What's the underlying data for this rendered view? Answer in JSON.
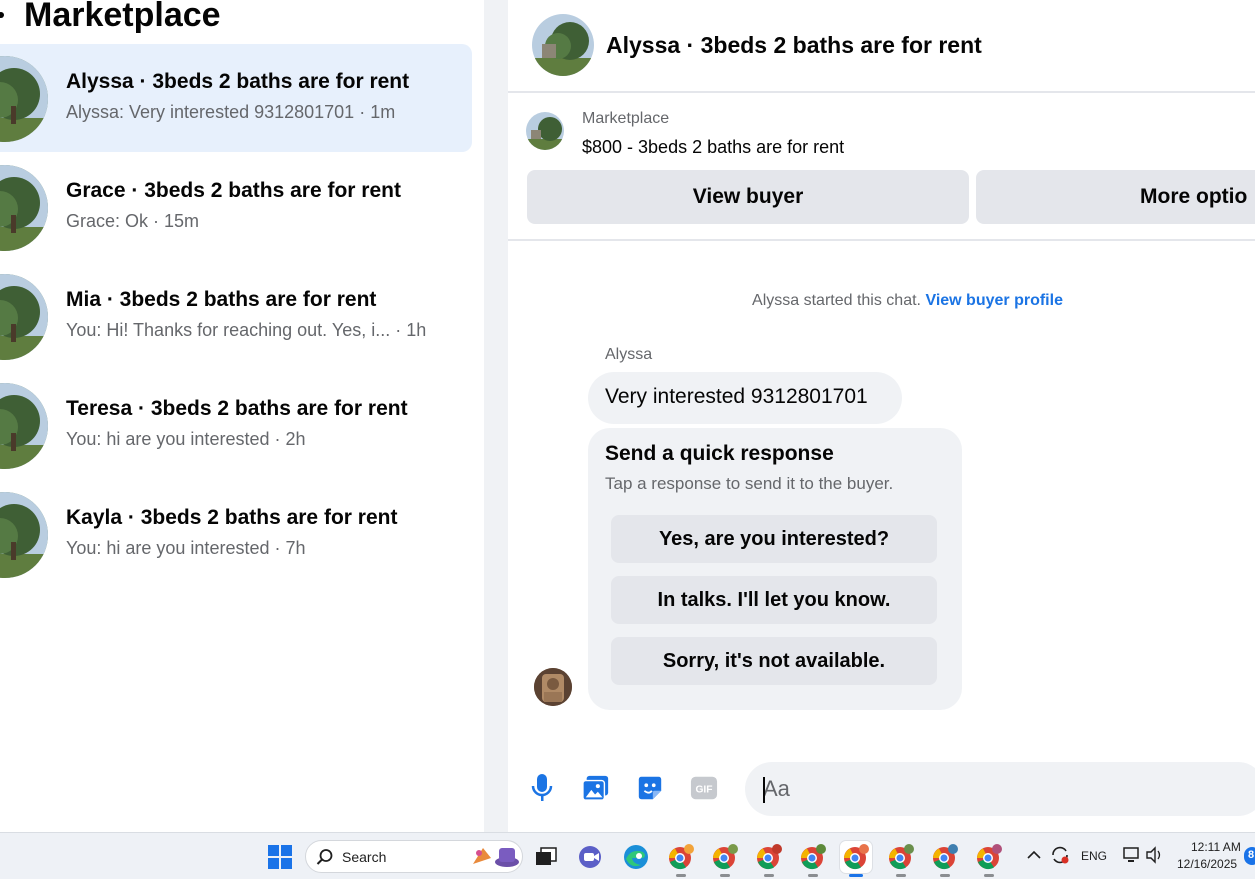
{
  "left": {
    "title": "Marketplace",
    "conversations": [
      {
        "title": "Alyssa · 3beds 2 baths are for rent",
        "preview": "Alyssa: Very interested 9312801701 · 1m",
        "active": true
      },
      {
        "title": "Grace · 3beds 2 baths are for rent",
        "preview": "Grace: Ok · 15m",
        "active": false
      },
      {
        "title": "Mia · 3beds 2 baths are for rent",
        "preview": "You: Hi! Thanks for reaching out. Yes, i... · 1h",
        "active": false
      },
      {
        "title": "Teresa · 3beds 2 baths are for rent",
        "preview": "You: hi are you interested · 2h",
        "active": false
      },
      {
        "title": "Kayla · 3beds 2 baths are for rent",
        "preview": "You: hi are you interested · 7h",
        "active": false
      }
    ]
  },
  "chat": {
    "header_title": "Alyssa · 3beds 2 baths are for rent",
    "listing_label": "Marketplace",
    "listing_price": "$800 - 3beds 2 baths are for rent",
    "view_buyer_label": "View buyer",
    "more_options_label": "More optio",
    "started_text": "Alyssa started this chat. ",
    "view_profile_label": "View buyer profile",
    "sender_name": "Alyssa",
    "message": "Very interested 9312801701",
    "quick_title": "Send a quick response",
    "quick_subtitle": "Tap a response to send it to the buyer.",
    "quick_responses": [
      "Yes, are you interested?",
      "In talks. I'll let you know.",
      "Sorry, it's not available."
    ],
    "composer_placeholder": "Aa",
    "composer_icons": [
      "microphone-icon",
      "photo-icon",
      "sticker-icon",
      "gif-icon"
    ]
  },
  "taskbar": {
    "search_label": "Search",
    "lang": "ENG",
    "time": "12:11 AM",
    "date": "12/16/2025",
    "notification_badge": "8"
  },
  "colors": {
    "accent": "#1b74e4",
    "active_row": "#e7f0fc",
    "button_gray": "#e4e6eb",
    "bubble_gray": "#f0f2f5"
  }
}
